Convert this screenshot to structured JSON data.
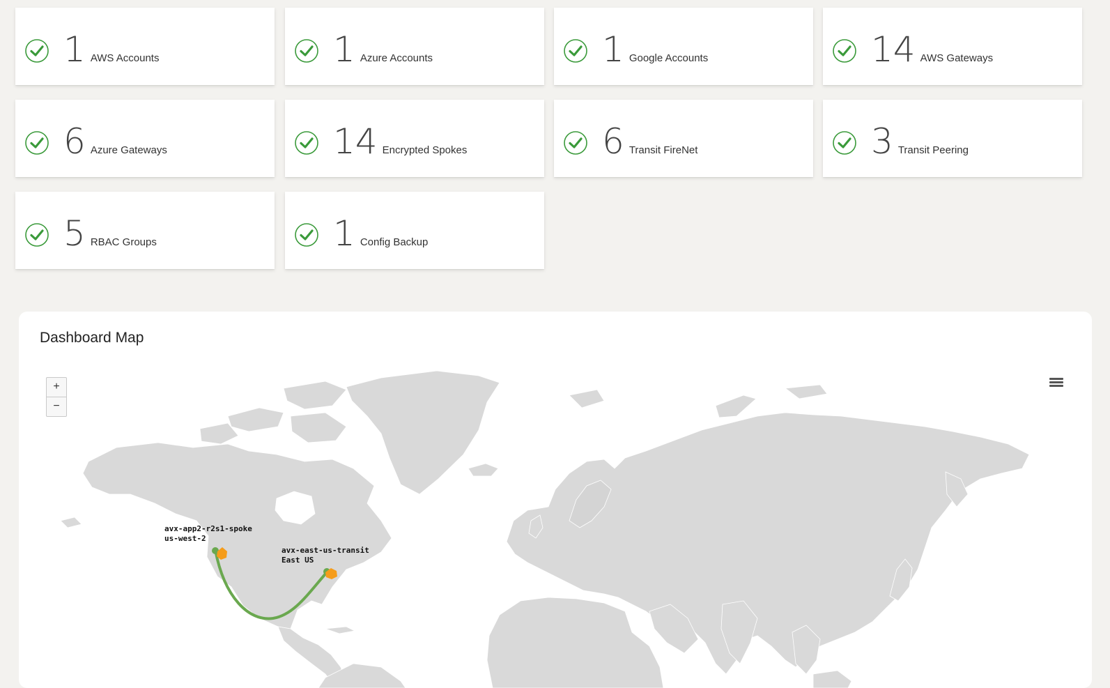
{
  "cards": [
    {
      "count": "1",
      "label": "AWS Accounts"
    },
    {
      "count": "1",
      "label": "Azure Accounts"
    },
    {
      "count": "1",
      "label": "Google Accounts"
    },
    {
      "count": "14",
      "label": "AWS Gateways"
    },
    {
      "count": "6",
      "label": "Azure Gateways"
    },
    {
      "count": "14",
      "label": "Encrypted Spokes"
    },
    {
      "count": "6",
      "label": "Transit FireNet"
    },
    {
      "count": "3",
      "label": "Transit Peering"
    },
    {
      "count": "5",
      "label": "RBAC Groups"
    },
    {
      "count": "1",
      "label": "Config Backup"
    }
  ],
  "map": {
    "title": "Dashboard Map",
    "zoom_in": "+",
    "zoom_out": "−",
    "menu_icon": "hamburger-menu-icon",
    "gateways": [
      {
        "name": "avx-app2-r2s1-spoke",
        "region": "us-west-2"
      },
      {
        "name": "avx-east-us-transit",
        "region": "East US"
      }
    ]
  },
  "colors": {
    "check": "#3a9a3a",
    "connection": "#6aa84f",
    "gateway": "#f59c1a",
    "land": "#d9d9d9"
  }
}
